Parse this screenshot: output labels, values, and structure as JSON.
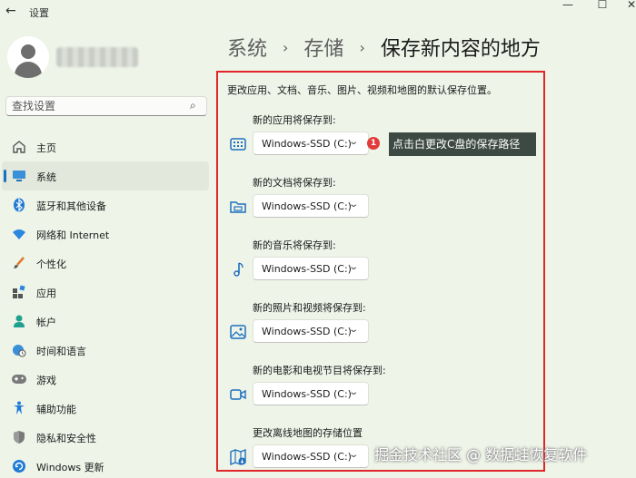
{
  "window": {
    "title": "设置",
    "back_glyph": "←",
    "minimize_glyph": "—",
    "maximize_glyph": "☐",
    "close_glyph": "✕"
  },
  "search": {
    "placeholder": "查找设置",
    "icon": "search-icon"
  },
  "sidebar": {
    "items": [
      {
        "label": "主页",
        "icon": "home-icon",
        "active": false
      },
      {
        "label": "系统",
        "icon": "display-icon",
        "active": true
      },
      {
        "label": "蓝牙和其他设备",
        "icon": "bluetooth-icon",
        "active": false
      },
      {
        "label": "网络和 Internet",
        "icon": "wifi-icon",
        "active": false
      },
      {
        "label": "个性化",
        "icon": "brush-icon",
        "active": false
      },
      {
        "label": "应用",
        "icon": "apps-icon",
        "active": false
      },
      {
        "label": "帐户",
        "icon": "account-icon",
        "active": false
      },
      {
        "label": "时间和语言",
        "icon": "globe-clock-icon",
        "active": false
      },
      {
        "label": "游戏",
        "icon": "gamepad-icon",
        "active": false
      },
      {
        "label": "辅助功能",
        "icon": "accessibility-icon",
        "active": false
      },
      {
        "label": "隐私和安全性",
        "icon": "shield-icon",
        "active": false
      },
      {
        "label": "Windows 更新",
        "icon": "update-icon",
        "active": false
      }
    ]
  },
  "breadcrumb": {
    "items": [
      "系统",
      "存储"
    ],
    "separator": "›",
    "current": "保存新内容的地方"
  },
  "main": {
    "intro": "更改应用、文档、音乐、图片、视频和地图的默认保存位置。",
    "settings": [
      {
        "label": "新的应用将保存到:",
        "value": "Windows-SSD (C:)",
        "icon": "apps-drive-icon"
      },
      {
        "label": "新的文档将保存到:",
        "value": "Windows-SSD (C:)",
        "icon": "documents-folder-icon"
      },
      {
        "label": "新的音乐将保存到:",
        "value": "Windows-SSD (C:)",
        "icon": "music-note-icon"
      },
      {
        "label": "新的照片和视频将保存到:",
        "value": "Windows-SSD (C:)",
        "icon": "picture-icon"
      },
      {
        "label": "新的电影和电视节目将保存到:",
        "value": "Windows-SSD (C:)",
        "icon": "video-camera-icon"
      },
      {
        "label": "更改离线地图的存储位置",
        "value": "Windows-SSD (C:)",
        "icon": "map-icon"
      }
    ],
    "chevron_glyph": "⌄"
  },
  "annotation": {
    "badge": "1",
    "tooltip": "点击白更改C盘的保存路径",
    "highlight_color": "#e0262a"
  },
  "watermark": "掘金技术社区 @ 数据蛙恢复软件",
  "colors": {
    "background": "#eef4e8",
    "accent": "#1a6fc2",
    "tooltip_bg": "#3d4a44"
  }
}
